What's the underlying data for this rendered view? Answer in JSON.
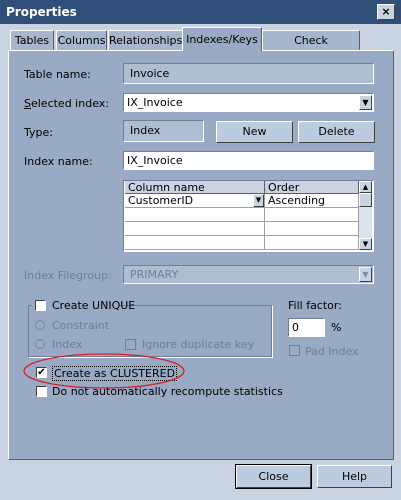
{
  "window": {
    "title": "Properties",
    "close_glyph": "×"
  },
  "tabs": [
    {
      "label": "Tables",
      "active": false
    },
    {
      "label": "Columns",
      "active": false
    },
    {
      "label": "Relationships",
      "active": false
    },
    {
      "label": "Indexes/Keys",
      "active": true
    },
    {
      "label": "Check Constraints",
      "active": false
    }
  ],
  "form": {
    "table_name_label": "Table name:",
    "table_name_value": "Invoice",
    "selected_index_label": "Selected index:",
    "selected_index_value": "IX_Invoice",
    "type_label": "Type:",
    "type_value": "Index",
    "new_button": "New",
    "delete_button": "Delete",
    "index_name_label": "Index name:",
    "index_name_value": "IX_Invoice"
  },
  "columns_grid": {
    "headers": [
      "Column name",
      "Order"
    ],
    "rows": [
      [
        "CustomerID",
        "Ascending"
      ],
      [
        "",
        ""
      ],
      [
        "",
        ""
      ],
      [
        "",
        ""
      ]
    ]
  },
  "filegroup": {
    "label": "Index Filegroup:",
    "value": "PRIMARY"
  },
  "unique_group": {
    "create_unique_label": "Create UNIQUE",
    "create_unique_checked": false,
    "constraint_label": "Constraint",
    "index_label": "Index",
    "ignore_duplicate_label": "Ignore duplicate key"
  },
  "fill_factor": {
    "label": "Fill factor:",
    "value": "0",
    "unit": "%",
    "pad_index_label": "Pad Index"
  },
  "clustered": {
    "label": "Create as CLUSTERED",
    "checked": true,
    "check_glyph": "✔"
  },
  "recompute": {
    "label": "Do not automatically recompute statistics",
    "checked": false
  },
  "footer": {
    "close_button": "Close",
    "help_button": "Help"
  },
  "annotation": {
    "color": "#d8202a"
  },
  "glyphs": {
    "dropdown": "▼",
    "scroll_up": "▲",
    "scroll_down": "▼"
  }
}
